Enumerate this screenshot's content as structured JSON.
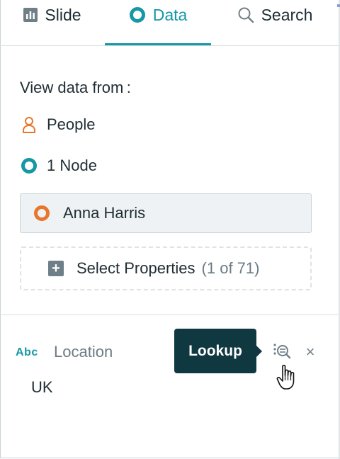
{
  "tabs": [
    {
      "label": "Slide",
      "icon": "chart-icon",
      "active": false
    },
    {
      "label": "Data",
      "icon": "ring-icon",
      "active": true
    },
    {
      "label": "Search",
      "icon": "search-icon",
      "active": false
    }
  ],
  "view_from_label": "View data from :",
  "source": {
    "type_label": "People",
    "node_count": "1 Node"
  },
  "selected_node": "Anna Harris",
  "select_properties": {
    "label": "Select Properties",
    "count": "(1 of 71)"
  },
  "property": {
    "type": "Abc",
    "name": "Location",
    "value": "UK"
  },
  "tooltip": "Lookup",
  "remove_symbol": "×",
  "colors": {
    "accent": "#1597a6",
    "person": "#e8762c",
    "tooltip_bg": "#0f3840"
  }
}
